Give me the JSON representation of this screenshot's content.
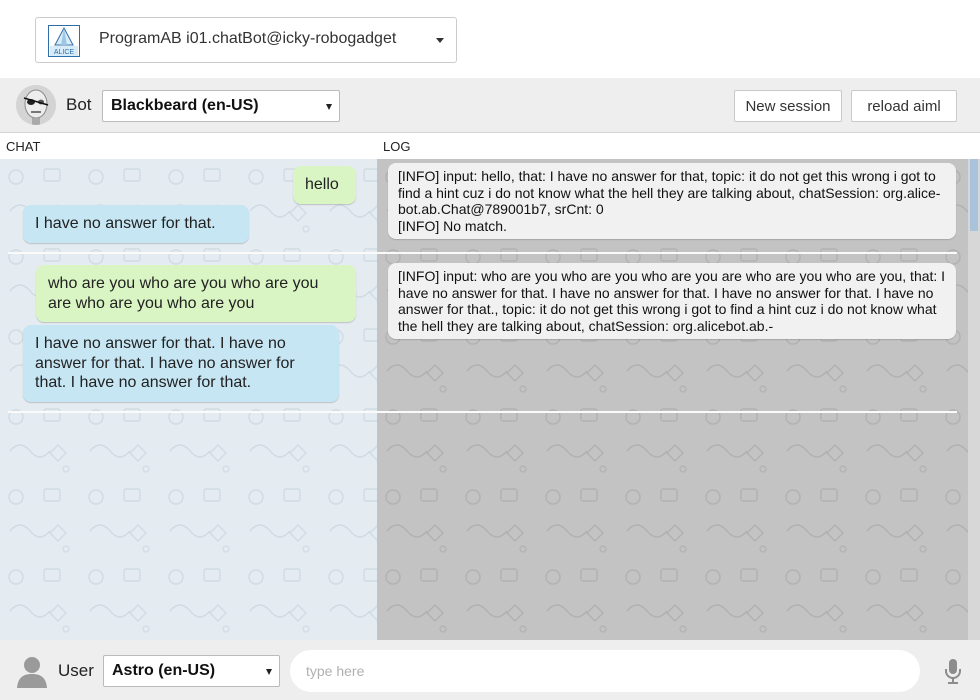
{
  "program": {
    "label": "ProgramAB  i01.chatBot@icky-robogadget",
    "logo_text": "ALICE"
  },
  "botbar": {
    "bot_label": "Bot",
    "bot_selected": "Blackbeard  (en-US)",
    "new_session_label": "New session",
    "reload_aiml_label": "reload aiml"
  },
  "headers": {
    "chat": "CHAT",
    "log": "LOG"
  },
  "chat": [
    {
      "user": "hello",
      "bot": "I have no answer for that.",
      "log": [
        "[INFO] input: hello, that: I have no answer for that, topic: it do not get this wrong i got to find a hint cuz i do not know what the hell they are talking about, chatSession: org.alice-bot.ab.Chat@789001b7, srCnt: 0",
        "[INFO] No match."
      ]
    },
    {
      "user": "who are you who are you who are you  are who are you who are you",
      "bot": "I have no answer for that. I have no answer for that. I have no answer for that. I have no answer for that.",
      "log": [
        "[INFO] input: who are you who are you who are you  are who are you who are you, that: I have no answer for that. I have no answer for that. I have no answer for that. I have no answer for that., topic: it do not get this wrong i got to find a hint cuz i do not know what the hell they are talking about, chatSession: org.alicebot.ab.-"
      ]
    }
  ],
  "userbar": {
    "user_label": "User",
    "user_selected": "Astro (en-US)",
    "input_value": "",
    "input_placeholder": "type here"
  },
  "colors": {
    "chat_bg": "#e4ebf1",
    "log_bg": "#c3c3c3",
    "user_bubble": "#daf5c4",
    "bot_bubble": "#c6e6f4",
    "log_bubble": "#f1f1f1",
    "scroll_thumb": "#a9c3dd"
  },
  "icons": {
    "logo": "alice-logo-icon",
    "bot_avatar": "robot-avatar-icon",
    "user_avatar": "user-silhouette-icon",
    "mic": "microphone-icon",
    "dropdown": "caret-down-icon"
  }
}
